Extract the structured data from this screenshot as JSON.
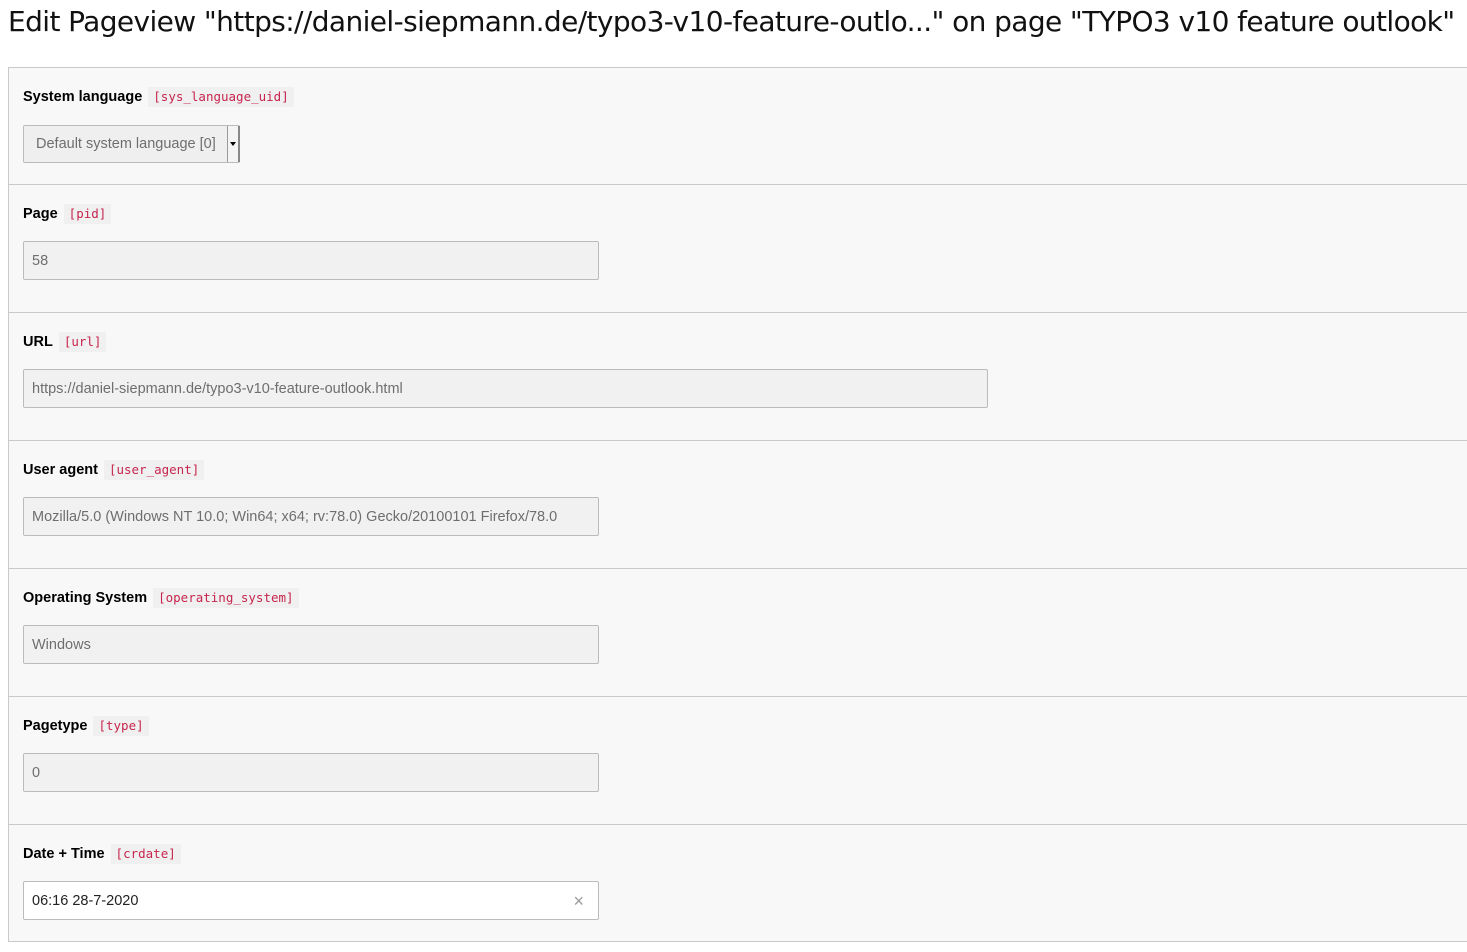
{
  "page": {
    "title": "Edit Pageview \"https://daniel-siepmann.de/typo3-v10-feature-outlo...\" on page \"TYPO3 v10 feature outlook\""
  },
  "fields": {
    "sys_language": {
      "label": "System language",
      "code": "[sys_language_uid]",
      "value": "Default system language [0]"
    },
    "pid": {
      "label": "Page",
      "code": "[pid]",
      "value": "58"
    },
    "url": {
      "label": "URL",
      "code": "[url]",
      "value": "https://daniel-siepmann.de/typo3-v10-feature-outlook.html"
    },
    "user_agent": {
      "label": "User agent",
      "code": "[user_agent]",
      "value": "Mozilla/5.0 (Windows NT 10.0; Win64; x64; rv:78.0) Gecko/20100101 Firefox/78.0"
    },
    "operating_system": {
      "label": "Operating System",
      "code": "[operating_system]",
      "value": "Windows"
    },
    "type": {
      "label": "Pagetype",
      "code": "[type]",
      "value": "0"
    },
    "crdate": {
      "label": "Date + Time",
      "code": "[crdate]",
      "value": "06:16 28-7-2020",
      "clear_icon": "close-icon"
    }
  },
  "colors": {
    "code_text": "#c7254e",
    "panel_bg": "#f8f8f8",
    "input_readonly_bg": "#f1f1f1",
    "border": "#c9c9c9"
  }
}
